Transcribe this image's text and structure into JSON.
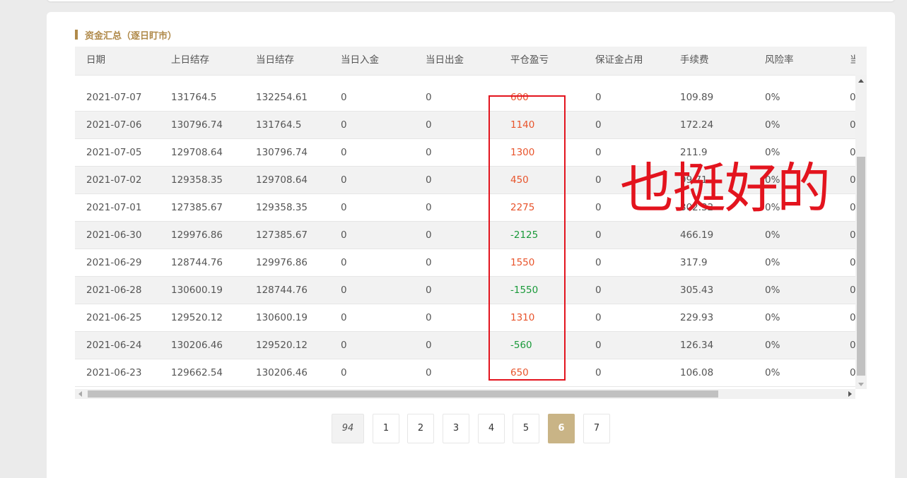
{
  "section": {
    "title": "资金汇总（逐日盯市）"
  },
  "table": {
    "headers": [
      "日期",
      "上日结存",
      "当日结存",
      "当日入金",
      "当日出金",
      "平仓盈亏",
      "保证金占用",
      "手续费",
      "风险率",
      "当日"
    ],
    "rows": [
      [
        "2021-07-07",
        "131764.5",
        "132254.61",
        "0",
        "0",
        "600",
        "0",
        "109.89",
        "0%",
        "0"
      ],
      [
        "2021-07-06",
        "130796.74",
        "131764.5",
        "0",
        "0",
        "1140",
        "0",
        "172.24",
        "0%",
        "0"
      ],
      [
        "2021-07-05",
        "129708.64",
        "130796.74",
        "0",
        "0",
        "1300",
        "0",
        "211.9",
        "0%",
        "0"
      ],
      [
        "2021-07-02",
        "129358.35",
        "129708.64",
        "0",
        "0",
        "450",
        "0",
        "99.71",
        "0%",
        "0"
      ],
      [
        "2021-07-01",
        "127385.67",
        "129358.35",
        "0",
        "0",
        "2275",
        "0",
        "302.32",
        "0%",
        "0"
      ],
      [
        "2021-06-30",
        "129976.86",
        "127385.67",
        "0",
        "0",
        "-2125",
        "0",
        "466.19",
        "0%",
        "0"
      ],
      [
        "2021-06-29",
        "128744.76",
        "129976.86",
        "0",
        "0",
        "1550",
        "0",
        "317.9",
        "0%",
        "0"
      ],
      [
        "2021-06-28",
        "130600.19",
        "128744.76",
        "0",
        "0",
        "-1550",
        "0",
        "305.43",
        "0%",
        "0"
      ],
      [
        "2021-06-25",
        "129520.12",
        "130600.19",
        "0",
        "0",
        "1310",
        "0",
        "229.93",
        "0%",
        "0"
      ],
      [
        "2021-06-24",
        "130206.46",
        "129520.12",
        "0",
        "0",
        "-560",
        "0",
        "126.34",
        "0%",
        "0"
      ],
      [
        "2021-06-23",
        "129662.54",
        "130206.46",
        "0",
        "0",
        "650",
        "0",
        "106.08",
        "0%",
        "0"
      ]
    ]
  },
  "annotation": {
    "text": "也挺好的",
    "color": "#e3141e"
  },
  "pagination": {
    "total": "94",
    "pages": [
      "1",
      "2",
      "3",
      "4",
      "5",
      "6",
      "7"
    ],
    "active": "6"
  },
  "colors": {
    "accent": "#b08a4a",
    "profit": "#e8542c",
    "loss": "#1a9a3a",
    "active_page": "#c9b486"
  }
}
